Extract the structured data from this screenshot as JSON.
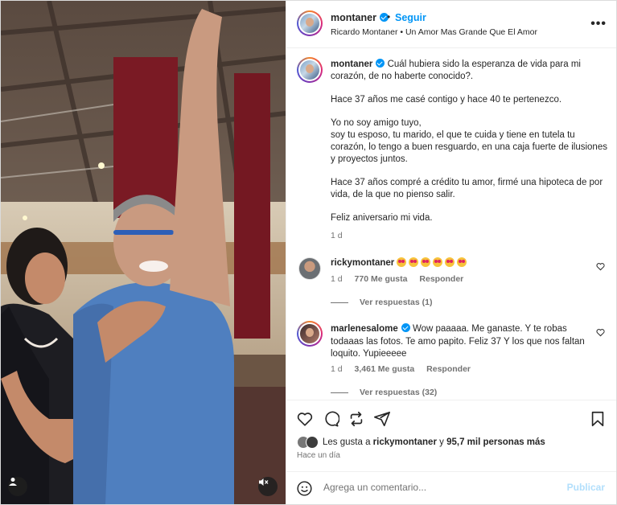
{
  "header": {
    "username": "montaner",
    "follow_label": "Seguir",
    "audio": "Ricardo Montaner • Un Amor Mas Grande Que El Amor",
    "more_label": "•••"
  },
  "caption": {
    "username": "montaner",
    "first_line": "Cuál hubiera sido la esperanza de vida para mi corazón, de no haberte conocido?.",
    "paragraphs": [
      "Hace 37 años me casé contigo y hace 40 te pertenezco.",
      "Yo no soy amigo tuyo,\nsoy tu esposo, tu marido, el que te cuida y tiene en tutela tu corazón, lo tengo a buen resguardo, en una caja fuerte de ilusiones y proyectos juntos.",
      "Hace 37 años compré a crédito tu amor, firmé una hipoteca de por vida, de la que no pienso salir.",
      "Feliz aniversario mi vida."
    ],
    "age": "1 d"
  },
  "comments": [
    {
      "username": "rickymontaner",
      "emoji_count": 6,
      "emoji_name": "heart-eyes-emoji",
      "age": "1 d",
      "likes": "770 Me gusta",
      "reply_label": "Responder",
      "replies_label": "Ver respuestas (1)"
    },
    {
      "username": "marlenesalome",
      "text": "Wow paaaaa. Me ganaste. Y te robas todaaas las fotos. Te amo papito. Feliz 37 Y los que nos faltan loquito. Yupieeeee",
      "age": "1 d",
      "likes": "3,461 Me gusta",
      "reply_label": "Responder",
      "replies_label": "Ver respuestas (32)"
    }
  ],
  "likes_summary": {
    "prefix": "Les gusta a",
    "user": "rickymontaner",
    "middle": "y",
    "others": "95,7 mil personas más"
  },
  "timestamp": "Hace un día",
  "add_comment": {
    "placeholder": "Agrega un comentario...",
    "publish_label": "Publicar"
  },
  "colors": {
    "accent": "#0095f6",
    "publish_disabled": "#b2dffc",
    "muted": "#737373",
    "text": "#262626"
  }
}
